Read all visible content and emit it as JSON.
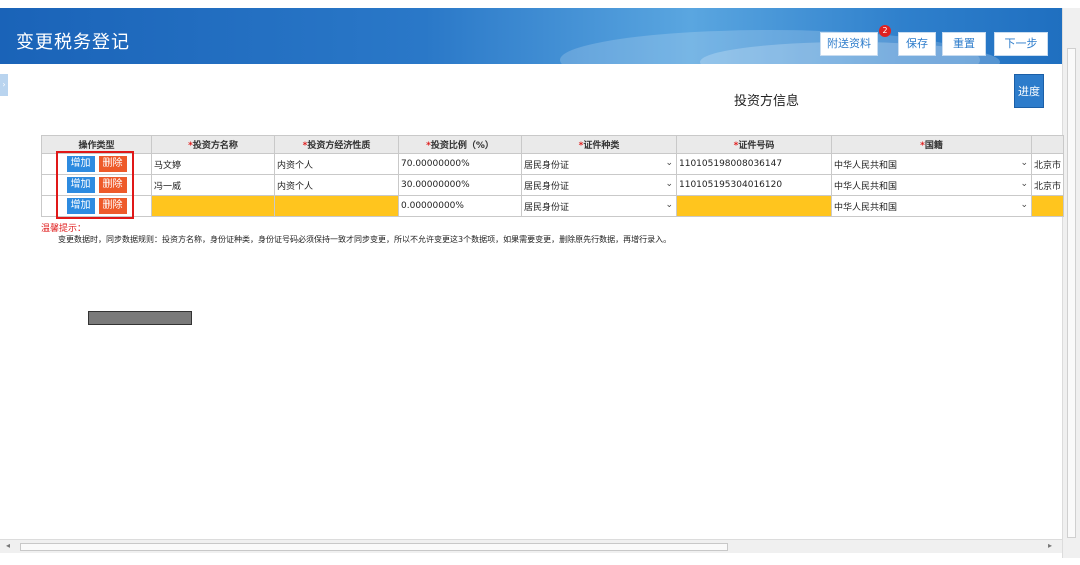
{
  "header": {
    "title": "变更税务登记",
    "buttons": {
      "attach": "附送资料",
      "attach_badge": "2",
      "save": "保存",
      "reset": "重置",
      "next": "下一步"
    }
  },
  "section": {
    "title": "投资方信息",
    "progress_button": "进度"
  },
  "table": {
    "headers": {
      "op": "操作类型",
      "name": "投资方名称",
      "nature": "投资方经济性质",
      "ratio": "投资比例（%）",
      "id_type": "证件种类",
      "id_no": "证件号码",
      "country": "国籍"
    },
    "required_mark": "*",
    "add_label": "增加",
    "delete_label": "删除",
    "rows": [
      {
        "name": "马文婷",
        "nature": "内资个人",
        "ratio": "70.00000000%",
        "id_type": "居民身份证",
        "id_no": "110105198008036147",
        "country": "中华人民共和国",
        "city": "北京市"
      },
      {
        "name": "冯一威",
        "nature": "内资个人",
        "ratio": "30.00000000%",
        "id_type": "居民身份证",
        "id_no": "110105195304016120",
        "country": "中华人民共和国",
        "city": "北京市"
      },
      {
        "name": "",
        "nature": "",
        "ratio": "0.00000000%",
        "id_type": "居民身份证",
        "id_no": "",
        "country": "中华人民共和国",
        "city": ""
      }
    ]
  },
  "tip": {
    "title": "温馨提示：",
    "body": "变更数据时，同步数据规则：投资方名称，身份证种类，身份证号码必须保持一致才同步变更，所以不允许变更这3个数据项，如果需要变更，删除原先行数据，再增行录入。"
  },
  "colors": {
    "header_blue": "#2a78c8",
    "add_button": "#2d8be0",
    "delete_button": "#ee5a2a",
    "required_cell": "#ffc51e",
    "highlight_box": "#e01818"
  }
}
